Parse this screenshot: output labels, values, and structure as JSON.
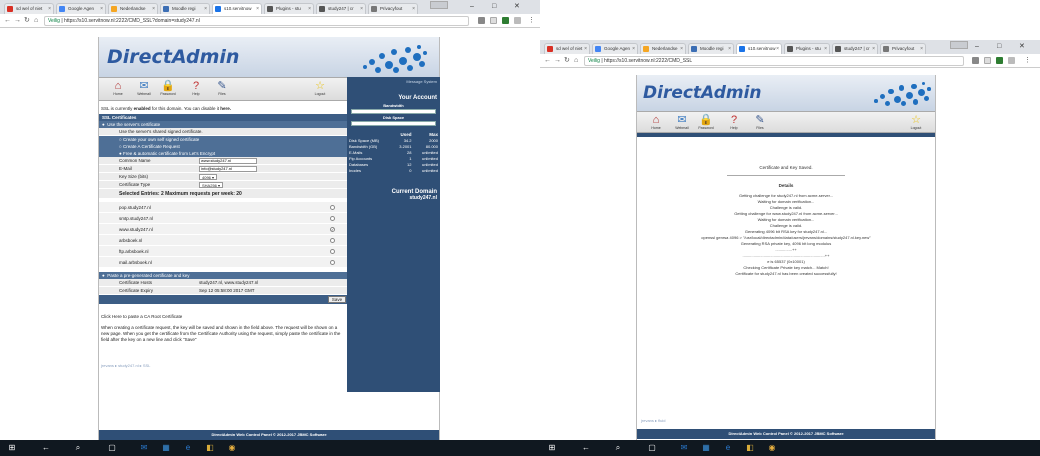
{
  "left": {
    "tabs": [
      {
        "label": "sd wel of niet",
        "color": "#d93025"
      },
      {
        "label": "Google Agen",
        "color": "#4285f4"
      },
      {
        "label": "Nederlandse",
        "color": "#f5a623"
      },
      {
        "label": "Moodle regi",
        "color": "#3c6eb4"
      },
      {
        "label": "s10.servitnow",
        "color": "#1a73e8"
      },
      {
        "label": "Plugins - stu",
        "color": "#555555"
      },
      {
        "label": "study247 | cr",
        "color": "#555555"
      },
      {
        "label": "Privacyfout",
        "color": "#777777"
      }
    ],
    "address": {
      "secure": "Veilig",
      "url": "https://s10.servitnow.nl:2222/CMD_SSL?domain=study247.nl"
    },
    "logo": "DirectAdmin",
    "icons": [
      {
        "label": "Home",
        "glyph": "⌂",
        "name": "home-icon"
      },
      {
        "label": "Webmail",
        "glyph": "✉",
        "name": "webmail-icon"
      },
      {
        "label": "Password",
        "glyph": "🔒",
        "name": "password-icon"
      },
      {
        "label": "Help",
        "glyph": "?",
        "name": "help-icon"
      },
      {
        "label": "Files",
        "glyph": "✎",
        "name": "files-icon"
      },
      {
        "label": "Logout",
        "glyph": "☆",
        "name": "logout-icon"
      }
    ],
    "side": {
      "message": "Message System",
      "account": "Your Account",
      "bandwidth": "Bandwidth",
      "disk": "Disk Space",
      "used": "Used",
      "max": "Max",
      "stats": [
        {
          "k": "Disk Space (MB)",
          "u": "34.2",
          "m": "2000"
        },
        {
          "k": "Bandwidth (GB)",
          "u": "3.2001",
          "m": "80.000"
        },
        {
          "k": "E-Mails",
          "u": "28",
          "m": "unlimited"
        },
        {
          "k": "Ftp Accounts",
          "u": "1",
          "m": "unlimited"
        },
        {
          "k": "Databases",
          "u": "12",
          "m": "unlimited"
        },
        {
          "k": "Inodes",
          "u": "0",
          "m": "unlimited"
        }
      ],
      "current_domain": "Current Domain",
      "domain": "study247.nl"
    },
    "ssl_status_pre": "SSL is currently",
    "ssl_status_bold": "enabled",
    "ssl_status_mid": "for this domain. You can disable it",
    "ssl_status_link": "here.",
    "section_title": "SSL Certificates",
    "opt_shared": "Use the server's certificate",
    "opt_shared_desc": "Use the server's shared signed certificate.",
    "opt_own": "Create your own self signed certificate",
    "opt_request": "Create A Certificate Request",
    "opt_letsencrypt": "Free & automatic certificate from Let's Encrypt",
    "fields": {
      "common_name_label": "Common Name",
      "common_name_value": "www.study247.nl",
      "email_label": "E-Mail",
      "email_value": "info@study247.nl",
      "keysize_label": "Key Size (bits)",
      "keysize_value": "4096 ▾",
      "certtype_label": "Certificate Type",
      "certtype_value": "SHA256 ▾"
    },
    "selected_entries": "Selected Entries: 2   Maximum requests per week: 20",
    "domains": [
      {
        "name": "pop.study247.nl",
        "mark": ""
      },
      {
        "name": "smtp.study247.nl",
        "mark": ""
      },
      {
        "name": "www.study247.nl",
        "mark": "✓"
      },
      {
        "name": "arbsboek.nl",
        "mark": ""
      },
      {
        "name": "ftp.arbsboek.nl",
        "mark": ""
      },
      {
        "name": "mail.arbsboek.nl",
        "mark": ""
      }
    ],
    "opt_paste": "Paste a pre-generated certificate and key",
    "cert_hosts_label": "Certificate Hosts",
    "cert_hosts_value": "study247.nl, www.study247.nl",
    "cert_expiry_label": "Certificate Expiry",
    "cert_expiry_value": "Sep 12 05:58:00 2017 GMT",
    "save": "Save",
    "ca_link": "Click Here to paste a CA Root Certificate",
    "help_text": "When creating a certificate request, the key will be saved and shown in the field above. The request will be shown on a new page. When you get the certificate from the Certificate Authority using the request, simply paste the certificate in the field after the key on a new line and click \"Save\"",
    "breadcrumb": "jrevans ▸ study247.nl ▸ SSL",
    "footer": "DirectAdmin Web Control Panel © 2012-2017 JBMC Software"
  },
  "right": {
    "tabs": [
      {
        "label": "sd wel of niet",
        "color": "#d93025"
      },
      {
        "label": "Google Agen",
        "color": "#4285f4"
      },
      {
        "label": "Nederlandse",
        "color": "#f5a623"
      },
      {
        "label": "Moodle regi",
        "color": "#3c6eb4"
      },
      {
        "label": "s10.servitnow",
        "color": "#1a73e8"
      },
      {
        "label": "Plugins - stu",
        "color": "#555555"
      },
      {
        "label": "study247 | cr",
        "color": "#555555"
      },
      {
        "label": "Privacyfout",
        "color": "#777777"
      }
    ],
    "address": {
      "secure": "Veilig",
      "url": "https://s10.servitnow.nl:2222/CMD_SSL"
    },
    "logo": "DirectAdmin",
    "icons": [
      {
        "label": "Home",
        "glyph": "⌂",
        "name": "home-icon"
      },
      {
        "label": "Webmail",
        "glyph": "✉",
        "name": "webmail-icon"
      },
      {
        "label": "Password",
        "glyph": "🔒",
        "name": "password-icon"
      },
      {
        "label": "Help",
        "glyph": "?",
        "name": "help-icon"
      },
      {
        "label": "Files",
        "glyph": "✎",
        "name": "files-icon"
      },
      {
        "label": "Logout",
        "glyph": "☆",
        "name": "logout-icon"
      }
    ],
    "saved": "Certificate and Key Saved.",
    "details": "Details",
    "log": [
      "Getting challenge for study247.nl from acme-server...",
      "Waiting for domain verification...",
      "Challenge is valid.",
      "Getting challenge for www.study247.nl from acme-server...",
      "Waiting for domain verification...",
      "Challenge is valid.",
      "Generating 4096 bit RSA key for study247.nl...",
      "openssl genrsa 4096 > \"/usr/local/directadmin/data/users/jrevans/domains/study247.nl.key.new\"",
      "Generating RSA private key, 4096 bit long modulus",
      "...............++",
      "..........................................................................++",
      "e is 65537 (0x10001)",
      "Checking Certificate Private key match... Match!",
      "Certificate for study247.nl has been created successfully!"
    ],
    "breadcrumb": "jrevans ▸ fluid",
    "footer": "DirectAdmin Web Control Panel © 2012-2017 JBMC Software"
  },
  "window": {
    "minimize": "–",
    "maximize": "□",
    "close": "✕"
  },
  "taskbar": [
    {
      "name": "windows-start-icon",
      "glyph": "⊞"
    },
    {
      "name": "back-icon",
      "glyph": "←"
    },
    {
      "name": "search-icon",
      "glyph": "⌕"
    },
    {
      "name": "task-view-icon",
      "glyph": "▢"
    },
    {
      "name": "outlook-icon",
      "glyph": "✉"
    },
    {
      "name": "photos-icon",
      "glyph": "▦"
    },
    {
      "name": "edge-icon",
      "glyph": "e"
    },
    {
      "name": "office-icon",
      "glyph": "◧"
    },
    {
      "name": "chrome-icon",
      "glyph": "◉"
    }
  ]
}
